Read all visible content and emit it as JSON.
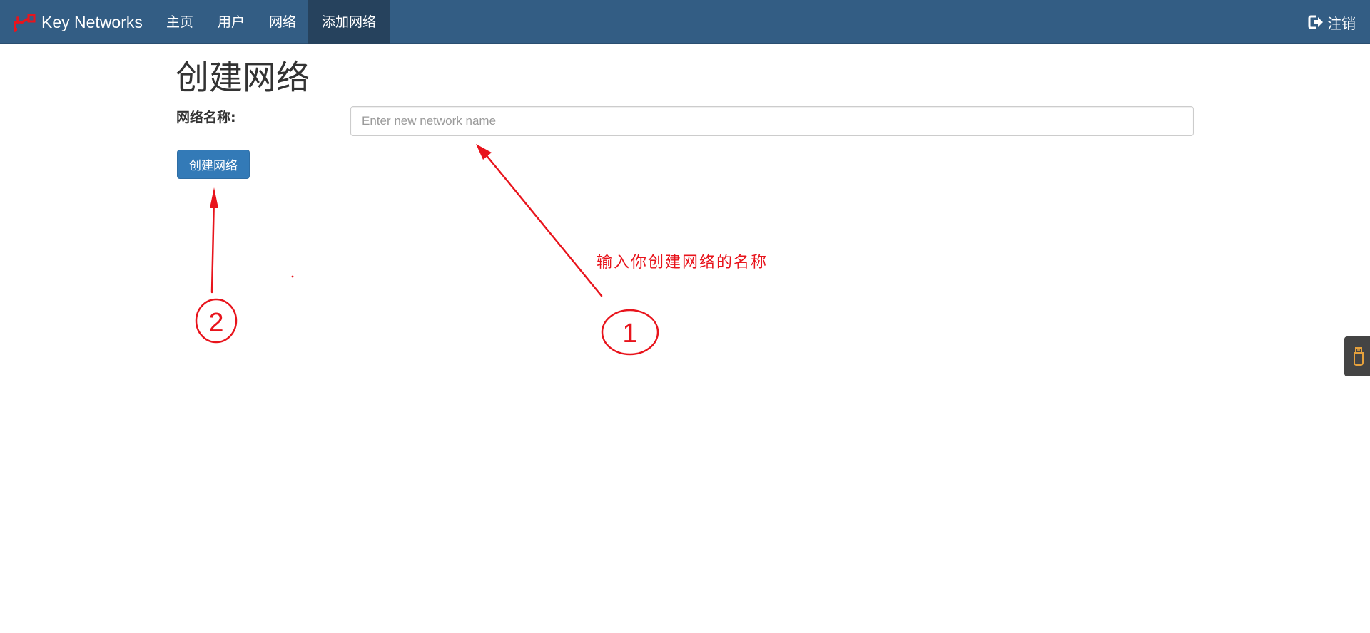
{
  "navbar": {
    "brand": "Key Networks",
    "items": [
      {
        "label": "主页",
        "active": false
      },
      {
        "label": "用户",
        "active": false
      },
      {
        "label": "网络",
        "active": false
      },
      {
        "label": "添加网络",
        "active": true
      }
    ],
    "logout_label": "注销",
    "colors": {
      "background": "#335d84",
      "active": "#26425d",
      "brand_icon": "#e8141c"
    }
  },
  "page": {
    "title": "创建网络",
    "field_label": "网络名称:",
    "input_value": "",
    "input_placeholder": "Enter new network name",
    "submit_label": "创建网络"
  },
  "annotations": {
    "note_text": "输入你创建网络的名称",
    "marker_1": "1",
    "marker_2": "2",
    "color": "#e8141c"
  },
  "icons": {
    "brand": "key-icon",
    "logout": "sign-out-icon",
    "side_widget": "plugin-icon"
  }
}
